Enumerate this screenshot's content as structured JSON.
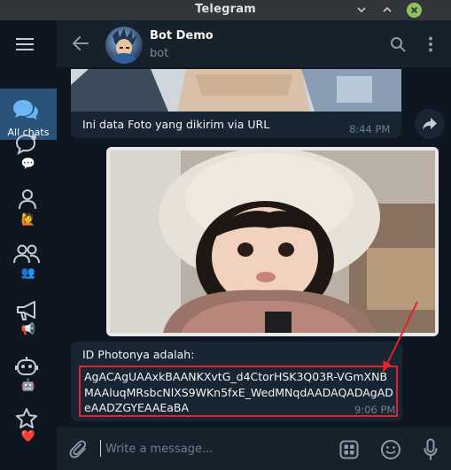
{
  "window": {
    "title": "Telegram"
  },
  "sidebar": {
    "folders": [
      {
        "label": "All chats",
        "icon": "chat-bubbles-icon",
        "active": true
      },
      {
        "label": "",
        "icon": "chat-bubble-outline-icon",
        "emoji": "💬"
      },
      {
        "label": "",
        "icon": "person-icon",
        "emoji": "🙋"
      },
      {
        "label": "",
        "icon": "people-icon",
        "emoji": "👥"
      },
      {
        "label": "",
        "icon": "megaphone-icon",
        "emoji": "📢"
      },
      {
        "label": "",
        "icon": "robot-icon",
        "emoji": "🤖"
      },
      {
        "label": "",
        "icon": "star-icon",
        "emoji": "❤️"
      }
    ]
  },
  "header": {
    "name": "Bot Demo",
    "status": "bot"
  },
  "messages": {
    "photo_url": {
      "caption": "Ini data Foto yang dikirim via URL",
      "time": "8:44 PM"
    },
    "photo_id": {
      "label": "ID Photonya adalah:",
      "id": "AgACAgUAAxkBAANKXvtG_d4CtorHSK3Q03R-VGmXNBMAAluqMRsbcNlXS9WKn5fxE_WedMNqdAADAQADAgADeAADZGYEAAEaBA",
      "time": "9:06 PM"
    }
  },
  "composer": {
    "placeholder": "Write a message..."
  },
  "colors": {
    "accent": "#2b5278",
    "highlight": "#e8202a",
    "bubble": "#182533",
    "background": "#0e1621"
  }
}
